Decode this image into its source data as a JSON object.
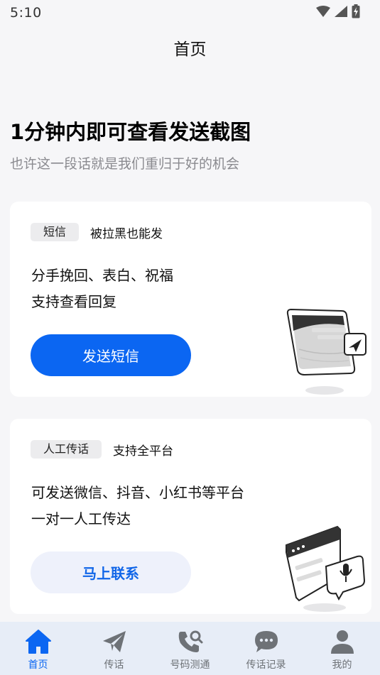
{
  "status_bar": {
    "time": "5:10"
  },
  "nav": {
    "title": "首页"
  },
  "hero": {
    "title": "1分钟内即可查看发送截图",
    "subtitle": "也许这一段话就是我们重归于好的机会"
  },
  "cards": [
    {
      "tag": "短信",
      "tag_desc": "被拉黑也能发",
      "lines": [
        "分手挽回、表白、祝福",
        "支持查看回复"
      ],
      "button_label": "发送短信"
    },
    {
      "tag": "人工传话",
      "tag_desc": "支持全平台",
      "lines": [
        "可发送微信、抖音、小红书等平台",
        "一对一人工传达"
      ],
      "button_label": "马上联系"
    }
  ],
  "tabs": [
    {
      "label": "首页",
      "icon": "home-icon",
      "active": true
    },
    {
      "label": "传话",
      "icon": "paper-plane-icon",
      "active": false
    },
    {
      "label": "号码测通",
      "icon": "phone-search-icon",
      "active": false
    },
    {
      "label": "传话记录",
      "icon": "chat-bubble-icon",
      "active": false
    },
    {
      "label": "我的",
      "icon": "user-icon",
      "active": false
    }
  ],
  "colors": {
    "accent": "#0b66f2",
    "background": "#f6f6f8",
    "tab_bar": "#e7edf7",
    "tab_inactive": "#6e7277"
  }
}
